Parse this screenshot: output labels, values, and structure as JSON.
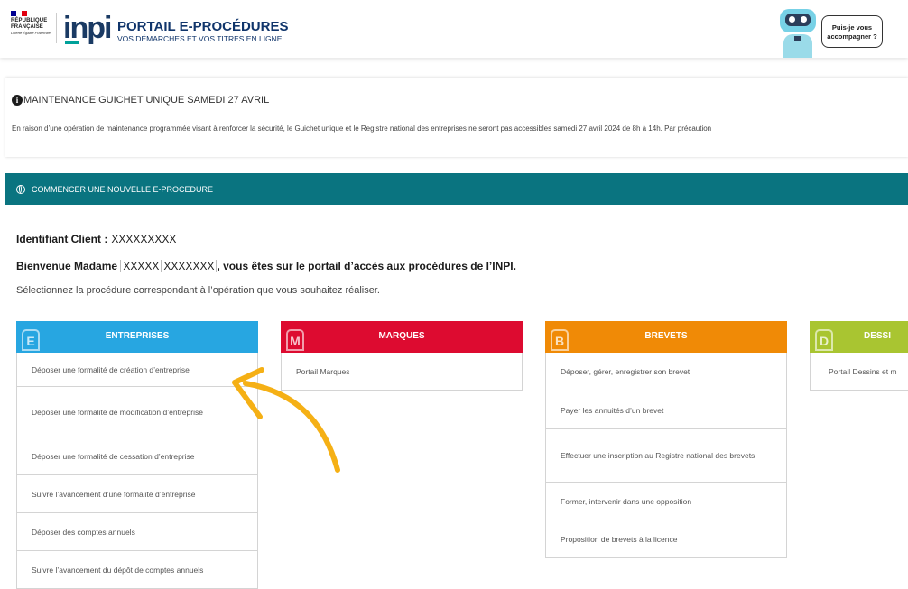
{
  "header": {
    "rf_name": "RÉPUBLIQUE\nFRANÇAISE",
    "rf_motto": "Liberté Égalité Fraternité",
    "logo_text": "inpi",
    "portal_title": "PORTAIL E-PROCÉDURES",
    "portal_subtitle": "VOS DÉMARCHES ET VOS TITRES EN LIGNE",
    "assistant_bubble": "Puis-je vous accompagner ?"
  },
  "maintenance": {
    "title": "MAINTENANCE GUICHET UNIQUE SAMEDI 27 AVRIL",
    "body": "En raison d’une opération de maintenance programmée visant à renforcer la sécurité, le Guichet unique et le Registre national des entreprises ne seront pas accessibles samedi 27 avril 2024 de 8h à 14h. Par précaution"
  },
  "section": {
    "title": "COMMENCER UNE NOUVELLE E-PROCEDURE"
  },
  "client": {
    "label": "Identifiant Client :",
    "value": "XXXXXXXXX"
  },
  "welcome": {
    "prefix": "Bienvenue Madame",
    "firstname": "XXXXX",
    "lastname": "XXXXXXX",
    "suffix": ", vous êtes sur le portail d’accès aux procédures de l’INPI.",
    "hint": "Sélectionnez la procédure correspondant à l’opération que vous souhaitez réaliser."
  },
  "cards": {
    "entreprises": {
      "badge": "E",
      "title": "ENTREPRISES",
      "color": "#27a6e1",
      "items": [
        "Déposer une formalité de création d’entreprise",
        "Déposer une formalité de modification d’entreprise",
        "Déposer une formalité de cessation d’entreprise",
        "Suivre l’avancement d’une formalité d’entreprise",
        "Déposer des comptes annuels",
        "Suivre l’avancement du dépôt de comptes annuels"
      ]
    },
    "marques": {
      "badge": "M",
      "title": "MARQUES",
      "color": "#dd0b30",
      "items": [
        "Portail Marques"
      ]
    },
    "brevets": {
      "badge": "B",
      "title": "BREVETS",
      "color": "#f08a06",
      "items": [
        "Déposer, gérer, enregistrer son brevet",
        "Payer les annuités d’un brevet",
        "Effectuer une inscription au Registre national des brevets",
        "Former, intervenir dans une opposition",
        "Proposition de brevets à la licence"
      ]
    },
    "dessins": {
      "badge": "D",
      "title": "DESSI",
      "color": "#a9c531",
      "items": [
        "Portail Dessins et m"
      ]
    }
  },
  "annotation_color": "#f5b015"
}
